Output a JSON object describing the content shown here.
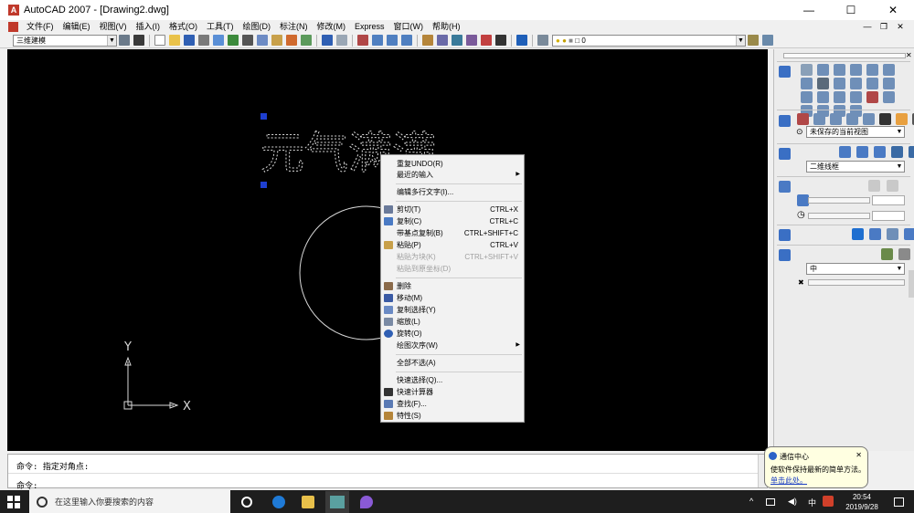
{
  "window": {
    "title": "AutoCAD 2007 - [Drawing2.dwg]",
    "app_icon": "autocad-a-icon",
    "minimize": "—",
    "maximize": "☐",
    "close": "✕"
  },
  "menus": [
    "文件(F)",
    "编辑(E)",
    "视图(V)",
    "插入(I)",
    "格式(O)",
    "工具(T)",
    "绘图(D)",
    "标注(N)",
    "修改(M)",
    "Express",
    "窗口(W)",
    "帮助(H)"
  ],
  "toolbar": {
    "workspace": "三维建模",
    "layer_value": "0"
  },
  "drawing": {
    "text": "元气满满",
    "ucs_x": "X",
    "ucs_y": "Y"
  },
  "context_menu": {
    "repeat": "重复UNDO(R)",
    "recent": "最近的输入",
    "edit_mtext": "编辑多行文字(I)...",
    "cut": "剪切(T)",
    "cut_sc": "CTRL+X",
    "copy": "复制(C)",
    "copy_sc": "CTRL+C",
    "copy_base": "带基点复制(B)",
    "copy_base_sc": "CTRL+SHIFT+C",
    "paste": "粘贴(P)",
    "paste_sc": "CTRL+V",
    "paste_block": "粘贴为块(K)",
    "paste_block_sc": "CTRL+SHIFT+V",
    "paste_orig": "粘贴到原坐标(D)",
    "erase": "删除",
    "move": "移动(M)",
    "copy_sel": "复制选择(Y)",
    "scale": "缩放(L)",
    "rotate": "旋转(O)",
    "draw_order": "绘图次序(W)",
    "deselect": "全部不选(A)",
    "qselect": "快速选择(Q)...",
    "quickcalc": "快速计算器",
    "find": "查找(F)...",
    "props": "特性(S)"
  },
  "palette": {
    "view_combo": "未保存的当前视图",
    "visual_style": "二维线框",
    "render_quality": "中"
  },
  "command": {
    "line1": "命令: 指定对角点:",
    "line2": "命令:"
  },
  "balloon": {
    "title": "通信中心",
    "body": "使软件保持最新的简单方法。",
    "link": "单击此处。"
  },
  "taskbar": {
    "search_placeholder": "在这里输入你要搜索的内容",
    "ime": "中",
    "time": "20:54",
    "date": "2019/9/28"
  },
  "colors": {
    "canvas": "#000000",
    "grip": "#1e3fd0",
    "entity": "#d8d8d8"
  }
}
